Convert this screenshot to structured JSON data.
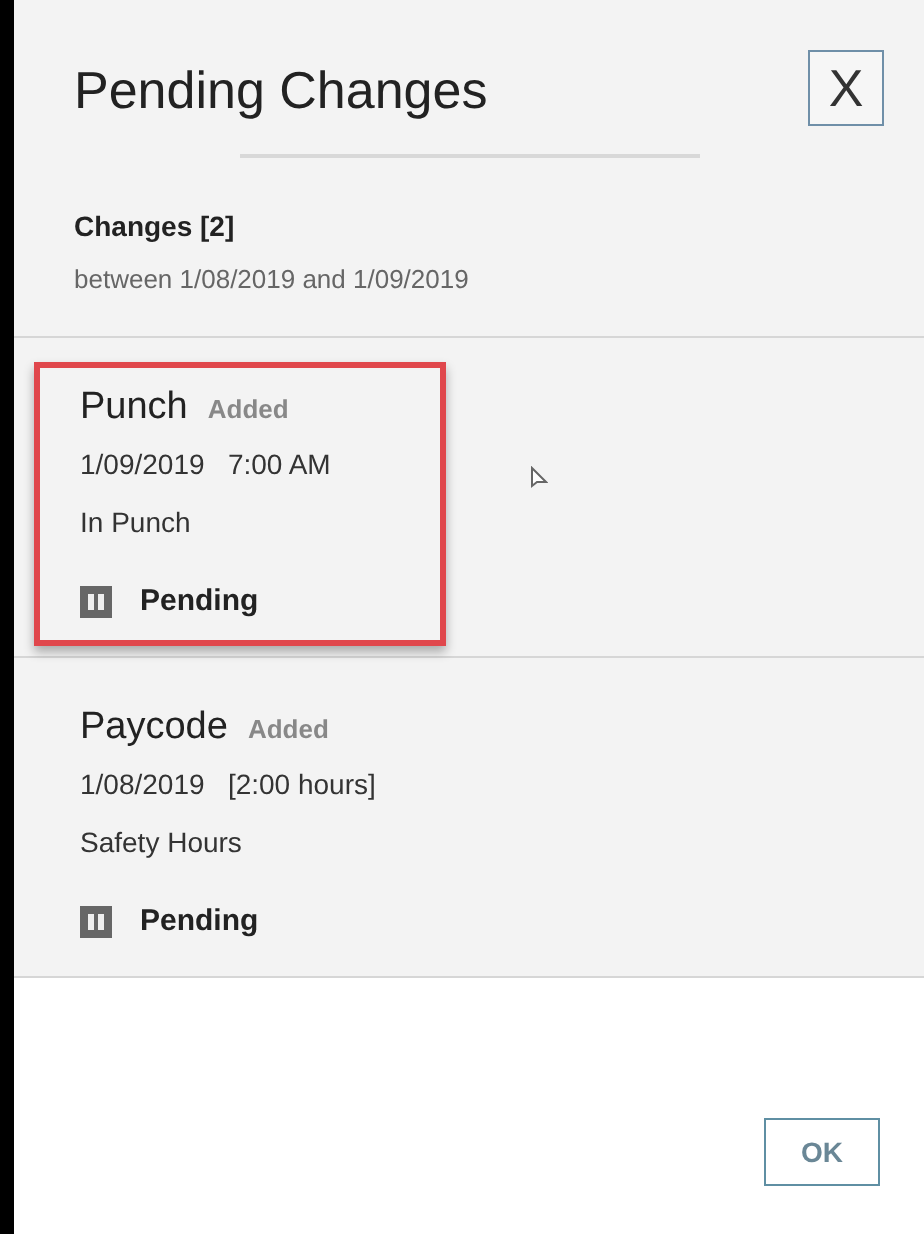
{
  "dialog": {
    "title": "Pending Changes",
    "close": "X"
  },
  "summary": {
    "heading": "Changes [2]",
    "range": "between 1/08/2019 and 1/09/2019"
  },
  "changes": [
    {
      "type": "Punch",
      "action": "Added",
      "detail": "1/09/2019   7:00 AM",
      "description": "In Punch",
      "status": "Pending",
      "highlighted": true
    },
    {
      "type": "Paycode",
      "action": "Added",
      "detail": "1/08/2019   [2:00 hours]",
      "description": "Safety Hours",
      "status": "Pending",
      "highlighted": false
    }
  ],
  "footer": {
    "ok": "OK"
  }
}
